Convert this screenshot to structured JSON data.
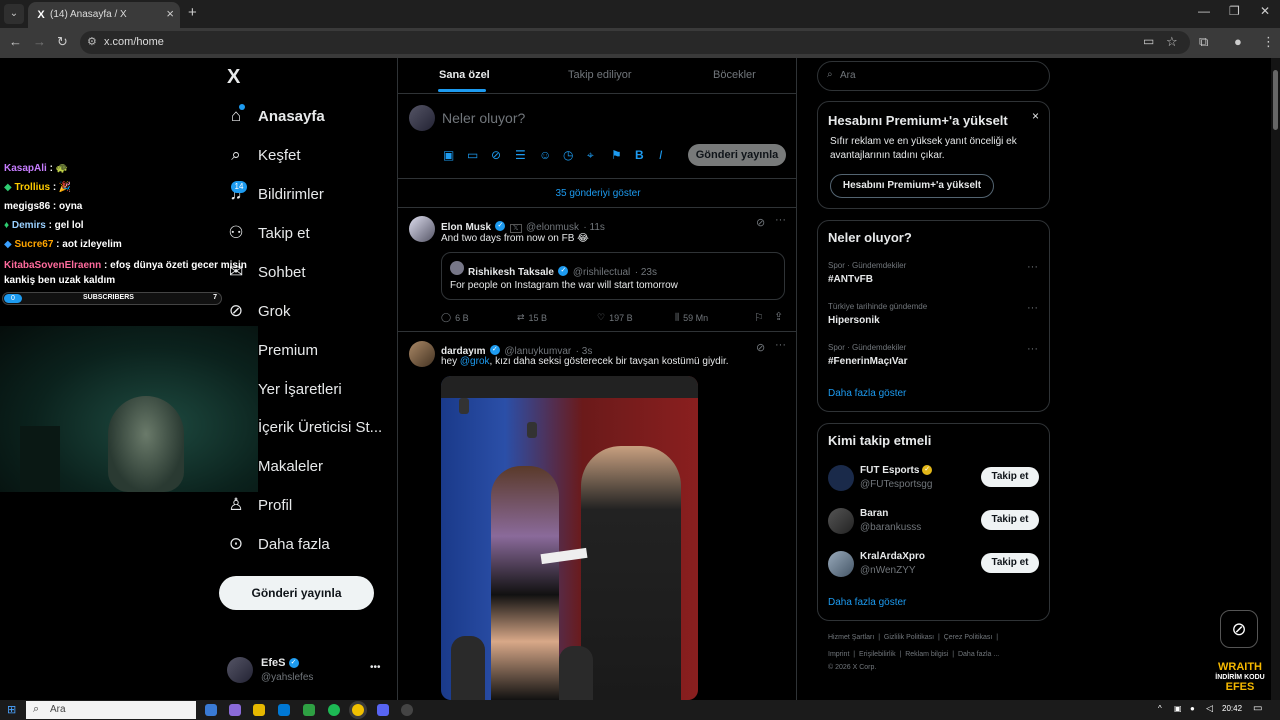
{
  "browser": {
    "tab_title": "(14) Anasayfa / X",
    "tab_favicon": "X",
    "url": "x.com/home"
  },
  "left_nav": {
    "logo": "X",
    "items": [
      {
        "label": "Anasayfa",
        "icon": "home-icon"
      },
      {
        "label": "Keşfet",
        "icon": "search-icon"
      },
      {
        "label": "Bildirimler",
        "icon": "bell-icon"
      },
      {
        "label": "Takip et",
        "icon": "follow-icon"
      },
      {
        "label": "Sohbet",
        "icon": "chat-icon"
      },
      {
        "label": "Grok",
        "icon": "grok-icon"
      },
      {
        "label": "Premium",
        "icon": "premium-icon"
      },
      {
        "label": "Yer İşaretleri",
        "icon": "bookmark-icon"
      },
      {
        "label": "İçerik Üreticisi St...",
        "icon": "studio-icon"
      },
      {
        "label": "Makaleler",
        "icon": "article-icon"
      },
      {
        "label": "Profil",
        "icon": "profile-icon"
      },
      {
        "label": "Daha fazla",
        "icon": "more-icon"
      }
    ],
    "notification_count": "14",
    "post_button": "Gönderi yayınla",
    "account": {
      "name": "EfeS",
      "handle": "@yahslefes",
      "menu": "•••"
    }
  },
  "feed": {
    "tabs": [
      "Sana özel",
      "Takip ediliyor",
      "Böcekler"
    ],
    "compose_placeholder": "Neler oluyor?",
    "compose_button": "Gönderi yayınla",
    "show_more": "35 gönderiyi göster",
    "posts": [
      {
        "name": "Elon Musk",
        "handle": "@elonmusk",
        "time": "· 11s",
        "text": "And two days from now on FB 😂",
        "quote": {
          "name": "Rishikesh Taksale",
          "handle": "@rishilectual",
          "time": "· 23s",
          "text": "For people on Instagram the war will start tomorrow"
        },
        "stats": {
          "replies": "6 B",
          "reposts": "15 B",
          "likes": "197 B",
          "views": "59 Mn"
        }
      },
      {
        "name": "dardayım",
        "handle": "@lanuykumvar",
        "time": "· 3s",
        "text_pre": "hey ",
        "mention": "@grok",
        "text_post": ", kızı daha seksi gösterecek bir tavşan kostümü giydir."
      }
    ]
  },
  "right": {
    "search_placeholder": "Ara",
    "premium_card": {
      "title": "Hesabını Premium+'a yükselt",
      "text": "Sıfır reklam ve en yüksek yanıt önceliği ek avantajlarının tadını çıkar.",
      "button": "Hesabını Premium+'a yükselt",
      "close": "×"
    },
    "trends": {
      "title": "Neler oluyor?",
      "items": [
        {
          "category": "Spor · Gündemdekiler",
          "name": "#ANTvFB"
        },
        {
          "category": "Türkiye tarihinde gündemde",
          "name": "Hipersonik"
        },
        {
          "category": "Spor · Gündemdekiler",
          "name": "#FenerinMaçıVar"
        }
      ],
      "show_more": "Daha fazla göster"
    },
    "who_to_follow": {
      "title": "Kimi takip etmeli",
      "items": [
        {
          "name": "FUT Esports",
          "handle": "@FUTesportsgg",
          "button": "Takip et"
        },
        {
          "name": "Baran",
          "handle": "@barankusss",
          "button": "Takip et"
        },
        {
          "name": "KralArdaXpro",
          "handle": "@nWenZYY",
          "button": "Takip et"
        }
      ],
      "show_more": "Daha fazla göster"
    },
    "footer": {
      "line1": [
        "Hizmet Şartları",
        "|",
        "Gizlilik Politikası",
        "|",
        "Çerez Politikası",
        "|"
      ],
      "line2": [
        "Imprint",
        "|",
        "Erişilebilirlik",
        "|",
        "Reklam bilgisi",
        "|",
        "Daha fazla ..."
      ],
      "copyright": "© 2026 X Corp."
    }
  },
  "overlay": {
    "chat": [
      {
        "user": "KasapAli",
        "msg": " : 🐢",
        "color": "#c77dff"
      },
      {
        "user": "Trollius",
        "msg": " : 🎉",
        "color": "#ffcc00"
      },
      {
        "user": "megigs86",
        "msg": " : oyna",
        "color": "#ffffff"
      },
      {
        "user": "Demirs",
        "msg": " : gel lol",
        "color": "#9ad0ff"
      },
      {
        "user": "Sucre67",
        "msg": " : aot izleyelim",
        "color": "#ffa500"
      },
      {
        "user": "KitabaSovenElraenn",
        "msg": " : efoş dünya özeti gecer misin kankiş ben uzak kaldım",
        "color": "#ff6b9d"
      }
    ],
    "subs_count_left": "0",
    "subs_label": "SUBSCRIBERS",
    "subs_count_right": "7",
    "wraith_lines": [
      "WRAITH",
      "İNDİRİM KODU",
      "EFES"
    ]
  },
  "taskbar": {
    "search": "Ara",
    "time": "20:42"
  }
}
